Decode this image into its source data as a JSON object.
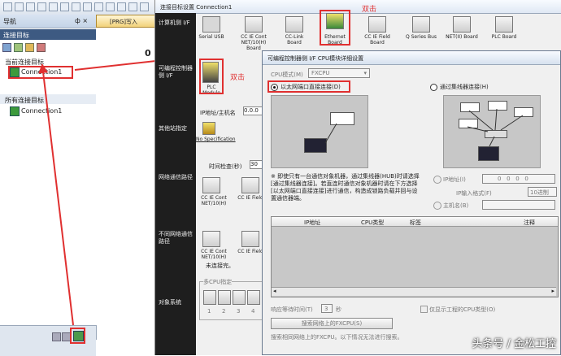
{
  "nav": {
    "title": "导航",
    "pin": "ф ×",
    "section": "连接目标",
    "current_heading": "当前连接目标",
    "current_item": "Connection1",
    "all_heading": "所有连接目标",
    "all_item": "Connection1"
  },
  "editor": {
    "tab_label": "[PRG]写入",
    "code_marker": "0"
  },
  "dialog": {
    "title": "连接目标设置 Connection1",
    "left_sections": [
      "计算机侧 I/F",
      "可编程控制器侧 I/F",
      "其他站指定",
      "网络通信路径",
      "不同网络通信路径",
      "对象系统"
    ],
    "top_connectors": [
      {
        "label": "Serial USB"
      },
      {
        "label": "CC IE Cont NET/10(H) Board"
      },
      {
        "label": "CC-Link Board"
      },
      {
        "label": "Ethernet Board"
      },
      {
        "label": "CC IE Field Board"
      },
      {
        "label": "Q Series Bus"
      },
      {
        "label": "NET(II) Board"
      },
      {
        "label": "PLC Board"
      }
    ],
    "plc_module_label": "PLC Module",
    "ip_label": "IP地址/主机名",
    "ip_value": "0.0.0",
    "no_spec_label": "No Specification",
    "timeout_label": "时间检查(秒)",
    "timeout_value": "30",
    "net_items": [
      "CC IE Cont NET/10(H)",
      "CC IE Field",
      "CC IE Cont NET/10(H)",
      "CC IE Field"
    ],
    "disconnected_note": "未连接完。",
    "multi_cpu_label": "多CPU指定",
    "multi_cpu_numbers": [
      "1",
      "2",
      "3",
      "4"
    ]
  },
  "subdialog": {
    "title": "可编程控制器侧 I/F CPU模块详细设置",
    "cpu_mode_label": "CPU模式(M)",
    "cpu_mode_value": "FXCPU",
    "radio_direct": "以太网端口直接连接(D)",
    "radio_hub": "通过集线器连接(H)",
    "note": "※ 即使只有一台通信对象机器，通过集线器(HUB)时请选择[通过集线器连接]。若直连时通信对象机器时请在下方选择[以太网端口直接连接]进行通信，构造成锁路负载并回与设置通信器端。",
    "ip_addr_label": "IP地址(I)",
    "ip_addr_value": "0   0   0   0",
    "ip_input_label": "IP输入格式(F)",
    "ip_input_value": "10进制",
    "host_label": "主机名(B)",
    "table_headers": [
      "IP地址",
      "CPU类型",
      "标签",
      "注释"
    ],
    "response_label": "响应等待时间(T)",
    "response_value": "3",
    "response_unit": "秒",
    "cpu_type_check": "仅显示工程的CPU类型(O)",
    "search_button": "搜索网络上的FXCPU(S)",
    "hint": "搜索相同网络上的FXCPU。以下情况无法进行搜索。"
  },
  "annotations": {
    "double_click_1": "双击",
    "double_click_2": "双击"
  },
  "watermark": "头条号 / 金松工控"
}
